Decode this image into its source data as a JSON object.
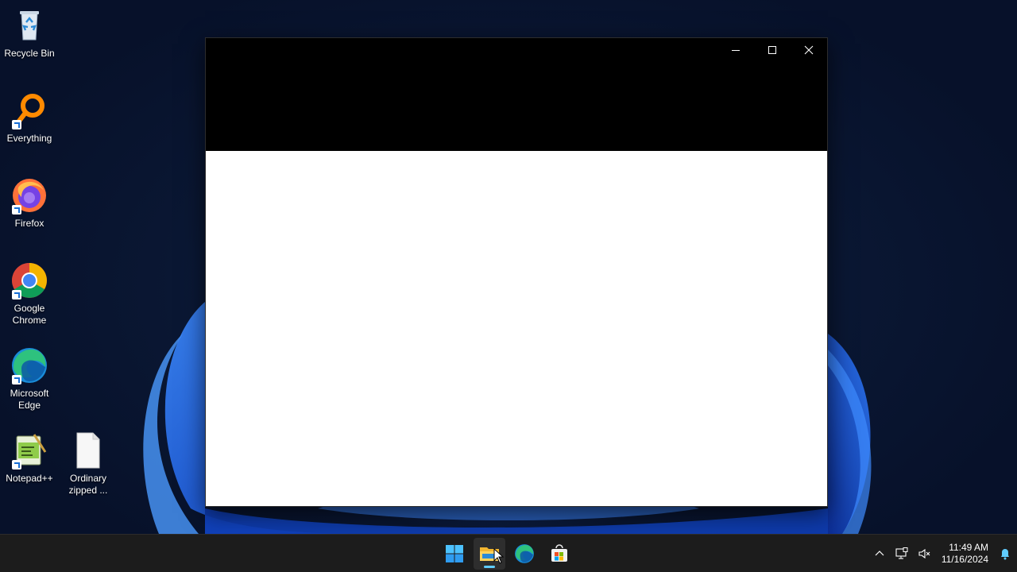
{
  "desktop": {
    "icons": [
      {
        "label": "Recycle Bin",
        "icon": "recycle-bin-icon"
      },
      {
        "label": "Everything",
        "icon": "everything-search-icon"
      },
      {
        "label": "Firefox",
        "icon": "firefox-icon"
      },
      {
        "label": "Google Chrome",
        "icon": "chrome-icon"
      },
      {
        "label": "Microsoft Edge",
        "icon": "edge-icon"
      },
      {
        "label": "Notepad++",
        "icon": "notepadpp-icon"
      },
      {
        "label": "Ordinary zipped ...",
        "icon": "blank-file-icon"
      }
    ]
  },
  "window": {
    "title": "",
    "controls": {
      "minimize": "minimize-icon",
      "maximize": "maximize-icon",
      "close": "close-icon"
    }
  },
  "taskbar": {
    "apps": [
      {
        "name": "Start",
        "icon": "windows-start-icon"
      },
      {
        "name": "File Explorer",
        "icon": "file-explorer-icon",
        "active": true
      },
      {
        "name": "Microsoft Edge",
        "icon": "edge-icon"
      },
      {
        "name": "Microsoft Store",
        "icon": "store-icon"
      }
    ],
    "tray": {
      "time": "11:49 AM",
      "date": "11/16/2024"
    }
  },
  "colors": {
    "taskbar_bg": "#1c1c1c",
    "accent": "#60cdff",
    "titlebar_bg": "#000000"
  }
}
